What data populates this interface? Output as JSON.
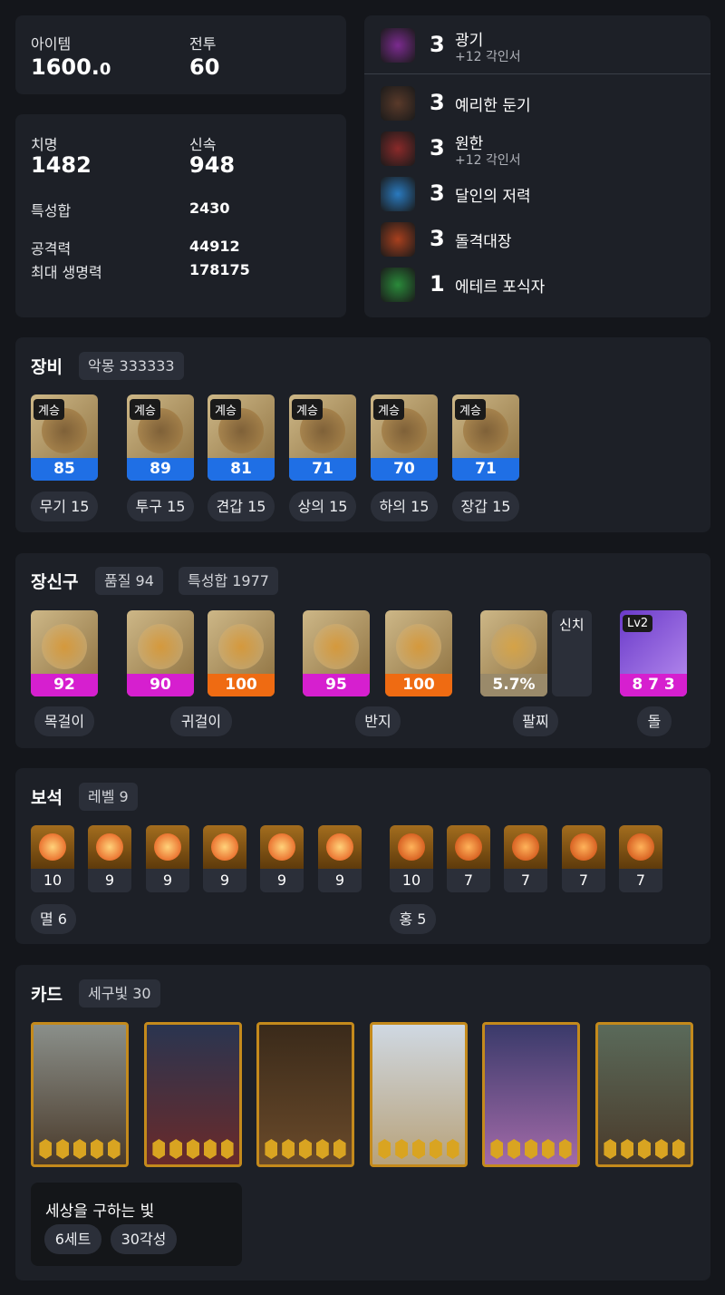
{
  "stats1": {
    "item_label": "아이템",
    "item_value": "1600.",
    "item_decimal": "0",
    "combat_label": "전투",
    "combat_value": "60"
  },
  "stats2": {
    "crit_label": "치명",
    "crit_value": "1482",
    "swift_label": "신속",
    "swift_value": "948",
    "total_label": "특성합",
    "total_value": "2430",
    "atk_label": "공격력",
    "atk_value": "44912",
    "hp_label": "최대 생명력",
    "hp_value": "178175"
  },
  "engravings": [
    {
      "level": "3",
      "name": "광기",
      "sub": "+12 각인서",
      "icon": "madness-icon",
      "color": "#7b2b8f"
    },
    {
      "level": "3",
      "name": "예리한 둔기",
      "sub": "",
      "icon": "keen-blunt-icon",
      "color": "#5a3a2a"
    },
    {
      "level": "3",
      "name": "원한",
      "sub": "+12 각인서",
      "icon": "grudge-icon",
      "color": "#8a2a2a"
    },
    {
      "level": "3",
      "name": "달인의 저력",
      "sub": "",
      "icon": "master-icon",
      "color": "#2a7abf"
    },
    {
      "level": "3",
      "name": "돌격대장",
      "sub": "",
      "icon": "raid-captain-icon",
      "color": "#a8401e"
    },
    {
      "level": "1",
      "name": "에테르 포식자",
      "sub": "",
      "icon": "ether-predator-icon",
      "color": "#2a8a3a"
    }
  ],
  "equipment": {
    "title": "장비",
    "set_chip": "악몽 333333",
    "items": [
      {
        "tag": "계승",
        "quality": "85",
        "label": "무기 15"
      },
      {
        "tag": "계승",
        "quality": "89",
        "label": "투구 15"
      },
      {
        "tag": "계승",
        "quality": "81",
        "label": "견갑 15"
      },
      {
        "tag": "계승",
        "quality": "71",
        "label": "상의 15"
      },
      {
        "tag": "계승",
        "quality": "70",
        "label": "하의 15"
      },
      {
        "tag": "계승",
        "quality": "71",
        "label": "장갑 15"
      }
    ],
    "bar_color": "#1f6fe5"
  },
  "accessories": {
    "title": "장신구",
    "quality_chip": "품질 94",
    "total_chip": "특성합 1977",
    "items": [
      {
        "quality": "92",
        "color": "#d61fcf"
      },
      {
        "quality": "90",
        "color": "#d61fcf"
      },
      {
        "quality": "100",
        "color": "#ef6b12"
      },
      {
        "quality": "95",
        "color": "#d61fcf"
      },
      {
        "quality": "100",
        "color": "#ef6b12"
      }
    ],
    "bracelet_value": "5.7%",
    "special_label": "신치",
    "stone_level": "Lv2",
    "stone_value": "8 7 3",
    "labels": [
      "목걸이",
      "귀걸이",
      "반지",
      "팔찌",
      "돌"
    ]
  },
  "gems": {
    "title": "보석",
    "level_chip": "레벨 9",
    "left": [
      "10",
      "9",
      "9",
      "9",
      "9",
      "9"
    ],
    "right": [
      "10",
      "7",
      "7",
      "7",
      "7"
    ],
    "left_label": "멸 6",
    "right_label": "홍 5"
  },
  "cards": {
    "title": "카드",
    "chip": "세구빛 30",
    "set_title": "세상을 구하는 빛",
    "set_tags": [
      "6세트",
      "30각성"
    ]
  }
}
